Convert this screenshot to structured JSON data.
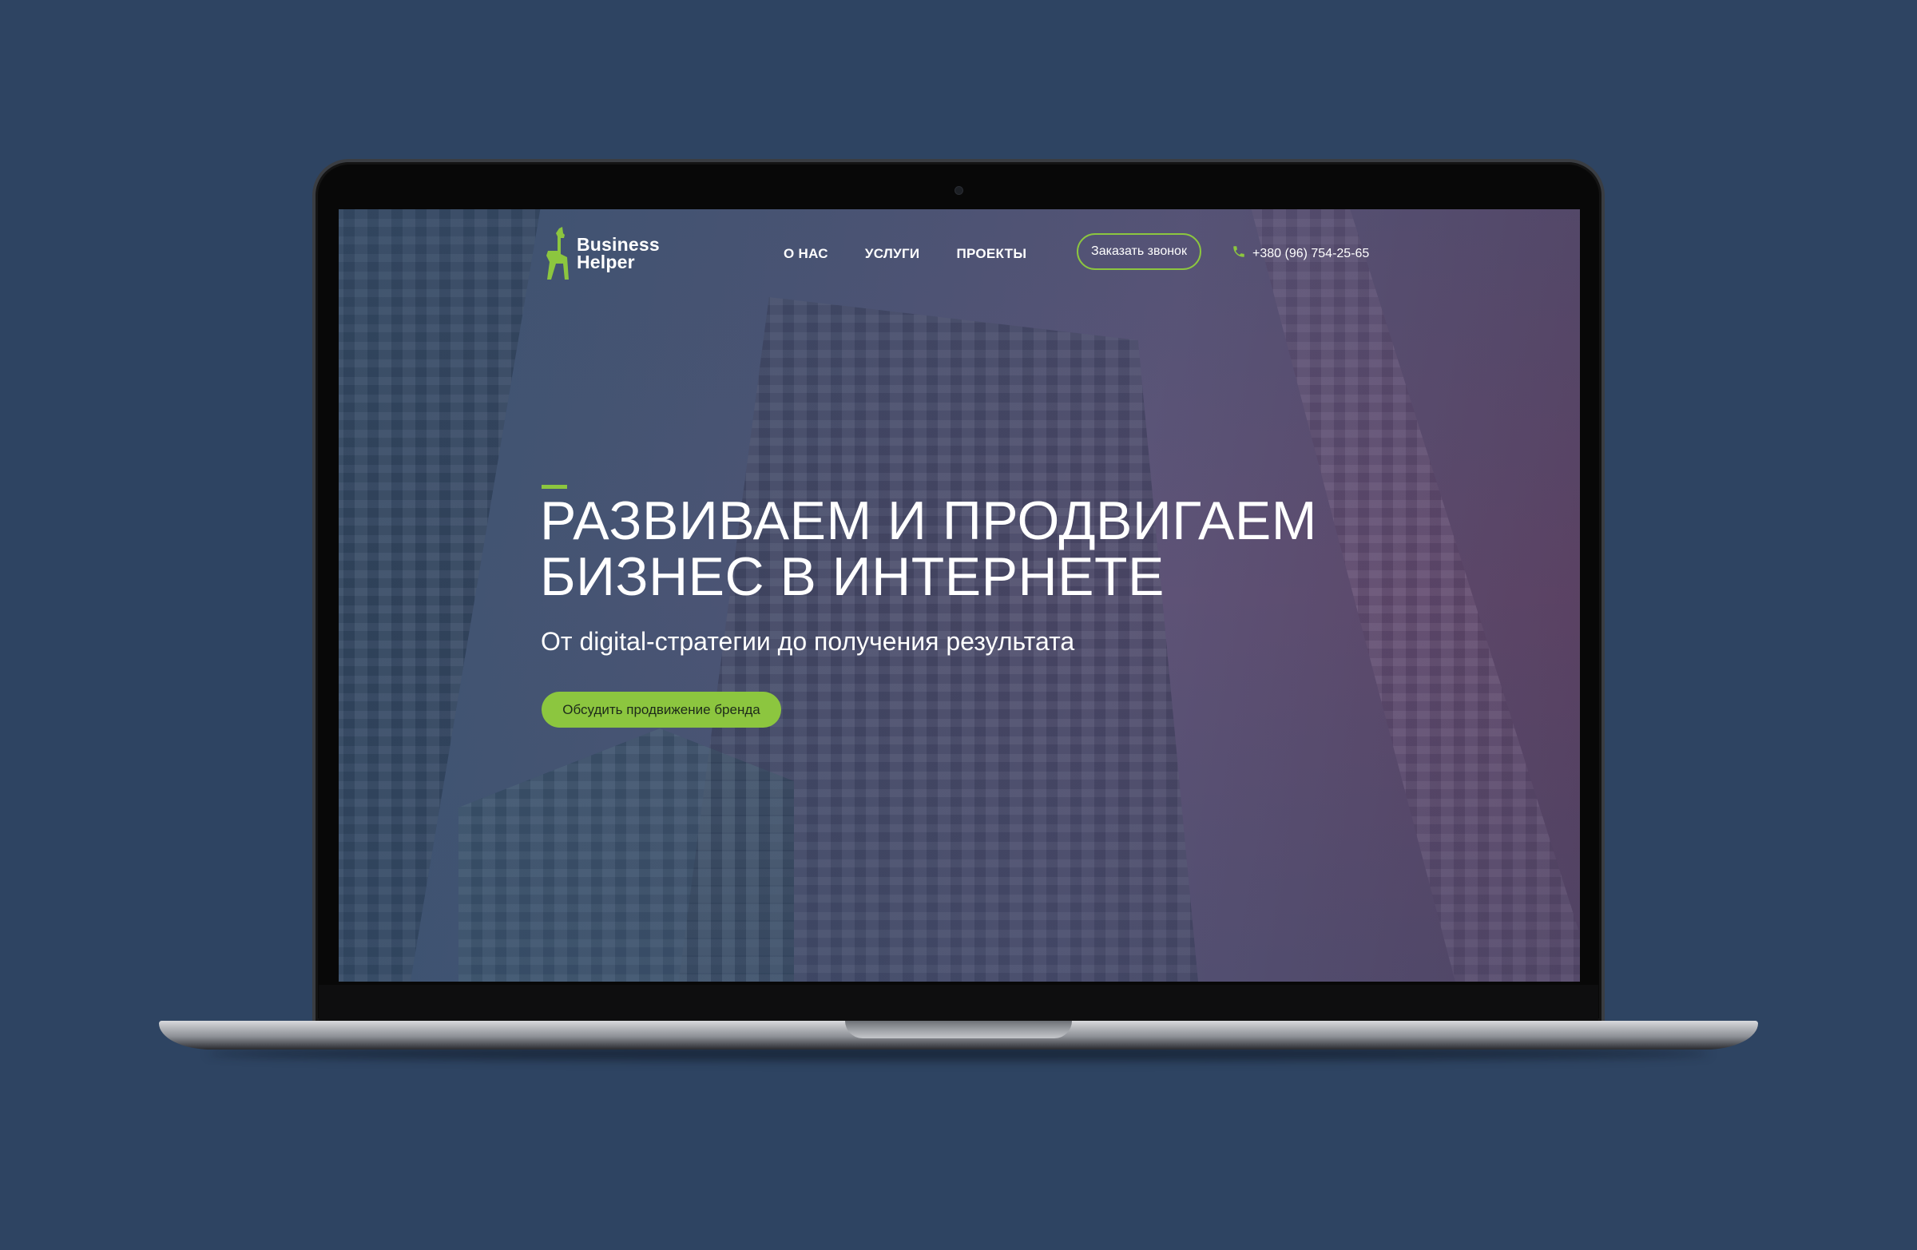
{
  "brand": {
    "name_line1": "Business",
    "name_line2": "Helper",
    "logo_icon": "llama-icon",
    "accent_color": "#8cc63f"
  },
  "nav": {
    "items": [
      {
        "label": "О НАС"
      },
      {
        "label": "УСЛУГИ"
      },
      {
        "label": "ПРОЕКТЫ"
      }
    ]
  },
  "header": {
    "callback_label": "Заказать звонок",
    "phone_icon": "phone-icon",
    "phone": "+380 (96) 754-25-65"
  },
  "hero": {
    "title_line1": "РАЗВИВАЕМ И ПРОДВИГАЕМ",
    "title_line2": "БИЗНЕС В ИНТЕРНЕТЕ",
    "subtitle": "От digital-стратегии до получения результата",
    "cta_label": "Обсудить продвижение бренда"
  },
  "colors": {
    "page_background": "#2e4462",
    "accent": "#8cc63f"
  }
}
